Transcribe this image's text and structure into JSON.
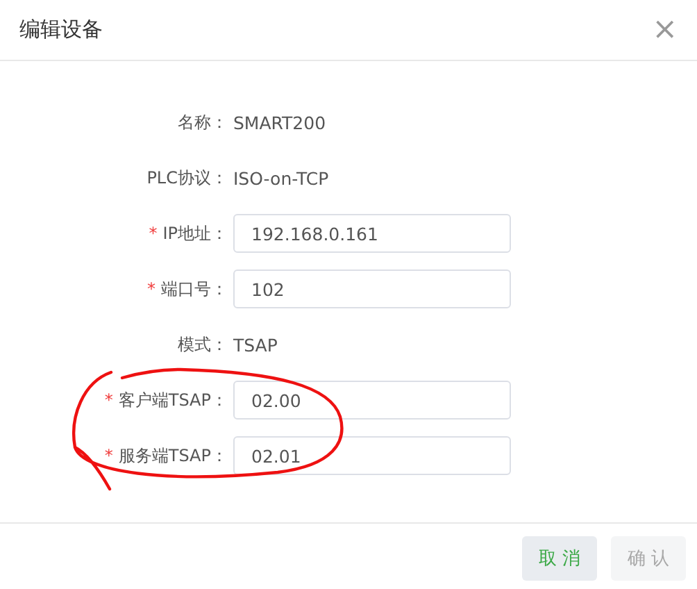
{
  "dialog": {
    "title": "编辑设备",
    "close": "×"
  },
  "fields": [
    {
      "label": "名称：",
      "kind": "text",
      "value": "SMART200"
    },
    {
      "label": "PLC协议：",
      "kind": "text",
      "value": "ISO-on-TCP"
    },
    {
      "marker": "*",
      "label": "IP地址：",
      "kind": "input",
      "value": "192.168.0.161"
    },
    {
      "marker": "*",
      "label": "端口号：",
      "kind": "input",
      "value": "102"
    },
    {
      "label": "模式：",
      "kind": "text",
      "value": "TSAP"
    },
    {
      "marker": "*",
      "label": "客户端TSAP：",
      "kind": "input",
      "value": "02.00"
    },
    {
      "marker": "*",
      "label": "服务端TSAP：",
      "kind": "input",
      "value": "02.01"
    }
  ],
  "buttons": [
    {
      "label": "取 消",
      "disabled": false
    },
    {
      "label": "确 认",
      "disabled": true
    }
  ]
}
